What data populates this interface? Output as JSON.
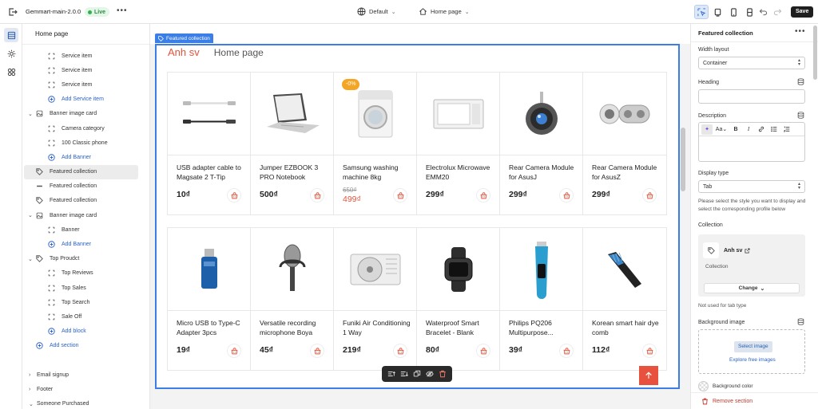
{
  "topbar": {
    "app_name": "Gemmart-main-2.0.0",
    "live_label": "Live",
    "theme": "Default",
    "page_select": "Home page",
    "save_label": "Save"
  },
  "sidebar": {
    "title": "Home page",
    "rows": [
      {
        "label": "Service item",
        "level": 2,
        "icon": "dashed-square-icon"
      },
      {
        "label": "Service item",
        "level": 2,
        "icon": "dashed-square-icon"
      },
      {
        "label": "Service item",
        "level": 2,
        "icon": "dashed-square-icon"
      },
      {
        "label": "Add Service item",
        "level": 2,
        "icon": "plus-circle-icon",
        "add": true
      },
      {
        "label": "Banner image card",
        "level": 1,
        "icon": "image-icon",
        "caret": "v"
      },
      {
        "label": "Camera category",
        "level": 2,
        "icon": "dashed-square-icon"
      },
      {
        "label": "100 Classic phone",
        "level": 2,
        "icon": "dashed-square-icon"
      },
      {
        "label": "Add Banner",
        "level": 2,
        "icon": "plus-circle-icon",
        "add": true
      },
      {
        "label": "Featured collection",
        "level": 1,
        "icon": "tag-icon",
        "selected": true
      },
      {
        "label": "Featured collection",
        "level": 1,
        "icon": "dash-icon"
      },
      {
        "label": "Featured collection",
        "level": 1,
        "icon": "tag-icon"
      },
      {
        "label": "Banner image card",
        "level": 1,
        "icon": "image-icon",
        "caret": "v"
      },
      {
        "label": "Banner",
        "level": 2,
        "icon": "dashed-square-icon"
      },
      {
        "label": "Add Banner",
        "level": 2,
        "icon": "plus-circle-icon",
        "add": true
      },
      {
        "label": "Top Proudct",
        "level": 1,
        "icon": "tag-icon",
        "caret": "v"
      },
      {
        "label": "Top Reviews",
        "level": 2,
        "icon": "dashed-square-icon"
      },
      {
        "label": "Top Sales",
        "level": 2,
        "icon": "dashed-square-icon"
      },
      {
        "label": "Top Search",
        "level": 2,
        "icon": "dashed-square-icon"
      },
      {
        "label": "Sale Off",
        "level": 2,
        "icon": "dashed-square-icon"
      },
      {
        "label": "Add block",
        "level": 2,
        "icon": "plus-circle-icon",
        "add": true
      },
      {
        "label": "Add section",
        "level": 1,
        "icon": "plus-circle-icon",
        "add": true
      },
      {
        "label": "",
        "level": 0,
        "icon": ""
      },
      {
        "label": "Email signup",
        "level": 0,
        "icon": "",
        "caret": ">"
      },
      {
        "label": "Footer",
        "level": 0,
        "icon": "",
        "caret": ">"
      },
      {
        "label": "Someone Purchased",
        "level": 0,
        "icon": "",
        "caret": "v"
      }
    ]
  },
  "canvas": {
    "selection_tag": "Featured collection",
    "tabs": [
      "Anh sv",
      "Home page"
    ],
    "products": [
      {
        "name": "USB adapter cable to Magsate 2 T-Tip",
        "price": "10₫",
        "img": "cable"
      },
      {
        "name": "Jumper EZBOOK 3 PRO Notebook",
        "price": "500₫",
        "img": "laptop"
      },
      {
        "name": "Samsung washing machine 8kg",
        "price": "499₫",
        "old_price": "650₫",
        "badge": "-0%",
        "img": "washer"
      },
      {
        "name": "Electrolux Microwave EMM20",
        "price": "299₫",
        "img": "microwave"
      },
      {
        "name": "Rear Camera Module for AsusJ",
        "price": "299₫",
        "img": "lens"
      },
      {
        "name": "Rear Camera Module for AsusZ",
        "price": "299₫",
        "img": "cammodule"
      },
      {
        "name": "Micro USB to Type-C Adapter 3pcs",
        "price": "19₫",
        "img": "usb"
      },
      {
        "name": "Versatile recording microphone Boya",
        "price": "45₫",
        "img": "mic"
      },
      {
        "name": "Funiki Air Conditioning 1 Way",
        "price": "219₫",
        "img": "ac"
      },
      {
        "name": "Waterproof Smart Bracelet - Blank",
        "price": "80₫",
        "img": "watch"
      },
      {
        "name": "Philips PQ206 Multipurpose...",
        "price": "39₫",
        "img": "trimmer"
      },
      {
        "name": "Korean smart hair dye comb",
        "price": "112₫",
        "img": "comb"
      }
    ]
  },
  "panel": {
    "title": "Featured collection",
    "width_label": "Width layout",
    "width_value": "Container",
    "heading_label": "Heading",
    "heading_value": "",
    "description_label": "Description",
    "display_type_label": "Display type",
    "display_type_value": "Tab",
    "display_hint": "Please select the style you want to display and select the corresponding profile below",
    "collection_label": "Collection",
    "collection_name": "Anh sv",
    "collection_sub": "Collection",
    "change_label": "Change",
    "not_used": "Not used for tab type",
    "bg_image_label": "Background image",
    "select_image": "Select image",
    "explore": "Explore free images",
    "bg_color_label": "Background color",
    "remove_label": "Remove section"
  },
  "colors": {
    "accent": "#3a7ee6",
    "brand_red": "#e2543d",
    "live_green": "#2fb24c"
  }
}
